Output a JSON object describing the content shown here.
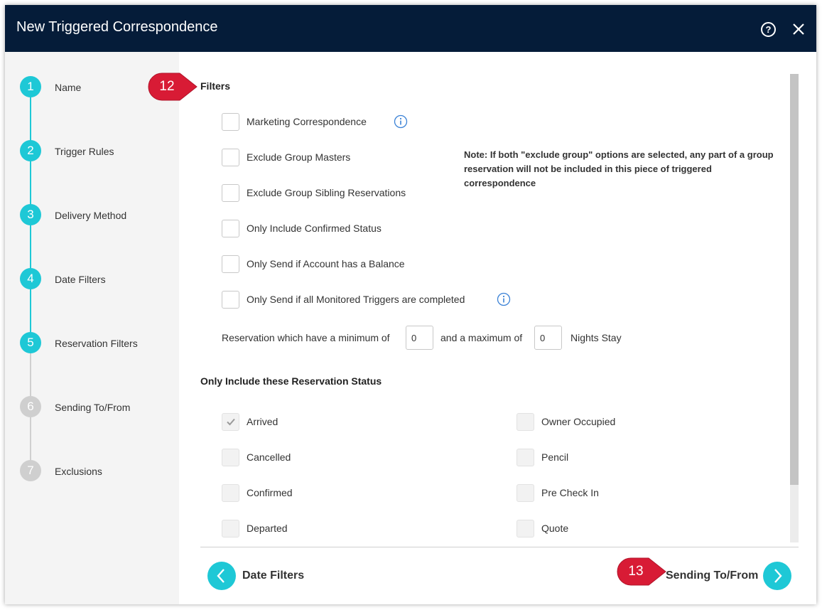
{
  "dialog": {
    "title": "New Triggered Correspondence",
    "help_glyph": "?",
    "help_icon": "help-circle-icon",
    "close_icon": "close-icon"
  },
  "steps": [
    {
      "number": "1",
      "label": "Name",
      "state": "complete"
    },
    {
      "number": "2",
      "label": "Trigger Rules",
      "state": "complete"
    },
    {
      "number": "3",
      "label": "Delivery Method",
      "state": "complete"
    },
    {
      "number": "4",
      "label": "Date Filters",
      "state": "complete"
    },
    {
      "number": "5",
      "label": "Reservation Filters",
      "state": "current"
    },
    {
      "number": "6",
      "label": "Sending To/From",
      "state": "pending"
    },
    {
      "number": "7",
      "label": "Exclusions",
      "state": "pending"
    }
  ],
  "filters": {
    "title": "Filters",
    "options": [
      {
        "label": "Marketing Correspondence",
        "checked": false,
        "has_info": true
      },
      {
        "label": "Exclude Group Masters",
        "checked": false,
        "has_info": false
      },
      {
        "label": "Exclude Group Sibling Reservations",
        "checked": false,
        "has_info": false
      },
      {
        "label": "Only Include Confirmed Status",
        "checked": false,
        "has_info": false
      },
      {
        "label": "Only Send if Account has a Balance",
        "checked": false,
        "has_info": false
      },
      {
        "label": "Only Send if all Monitored Triggers are completed",
        "checked": false,
        "has_info": true
      }
    ],
    "note": "Note: If both \"exclude group\" options are selected, any part of a group reservation will not be included in this piece of triggered correspondence",
    "nights": {
      "prefix": "Reservation which have a minimum of",
      "min_value": "0",
      "middle": "and a maximum of",
      "max_value": "0",
      "suffix": "Nights Stay"
    }
  },
  "status_section": {
    "title": "Only Include these Reservation Status",
    "left_column": [
      {
        "label": "Arrived",
        "checked": true,
        "disabled": true
      },
      {
        "label": "Cancelled",
        "checked": false,
        "disabled": true
      },
      {
        "label": "Confirmed",
        "checked": false,
        "disabled": true
      },
      {
        "label": "Departed",
        "checked": false,
        "disabled": true
      }
    ],
    "right_column": [
      {
        "label": "Owner Occupied",
        "checked": false,
        "disabled": true
      },
      {
        "label": "Pencil",
        "checked": false,
        "disabled": true
      },
      {
        "label": "Pre Check In",
        "checked": false,
        "disabled": true
      },
      {
        "label": "Quote",
        "checked": false,
        "disabled": true
      }
    ]
  },
  "footer": {
    "back_label": "Date Filters",
    "next_label": "Sending To/From"
  },
  "callouts": {
    "filters_marker": "12",
    "next_marker": "13"
  },
  "colors": {
    "titlebar": "#051c39",
    "accent": "#1ec8d6",
    "callout": "#d81b35",
    "info": "#3b82d6"
  }
}
